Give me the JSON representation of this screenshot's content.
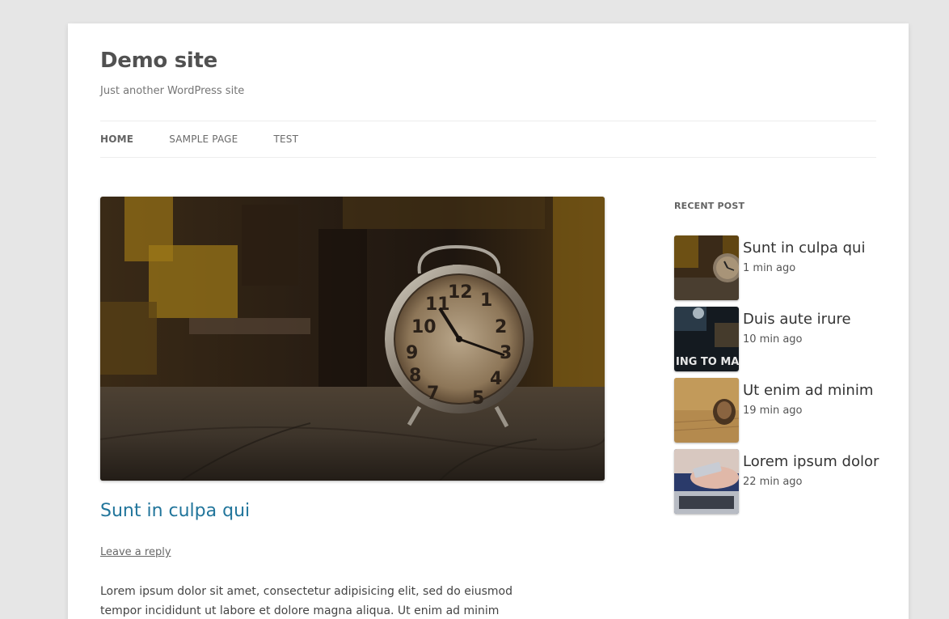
{
  "site": {
    "title": "Demo site",
    "description": "Just another WordPress site"
  },
  "nav": {
    "items": [
      {
        "label": "HOME"
      },
      {
        "label": "SAMPLE PAGE"
      },
      {
        "label": "TEST"
      }
    ]
  },
  "post": {
    "title": "Sunt in culpa qui",
    "leave_reply": "Leave a reply",
    "content": "Lorem ipsum dolor sit amet, consectetur adipisicing elit, sed do eiusmod tempor incididunt ut labore et dolore magna aliqua. Ut enim ad minim veniam,",
    "image_icon": "alarm-clock-photo"
  },
  "sidebar": {
    "widget_title": "RECENT POST",
    "posts": [
      {
        "title": "Sunt in culpa qui",
        "time": "1 min ago"
      },
      {
        "title": "Duis aute irure",
        "time": "10 min ago"
      },
      {
        "title": "Ut enim ad minim",
        "time": "19 min ago"
      },
      {
        "title": "Lorem ipsum dolor",
        "time": "22 min ago"
      }
    ]
  },
  "colors": {
    "background": "#e6e6e6",
    "link": "#21759b",
    "text": "#444444"
  }
}
